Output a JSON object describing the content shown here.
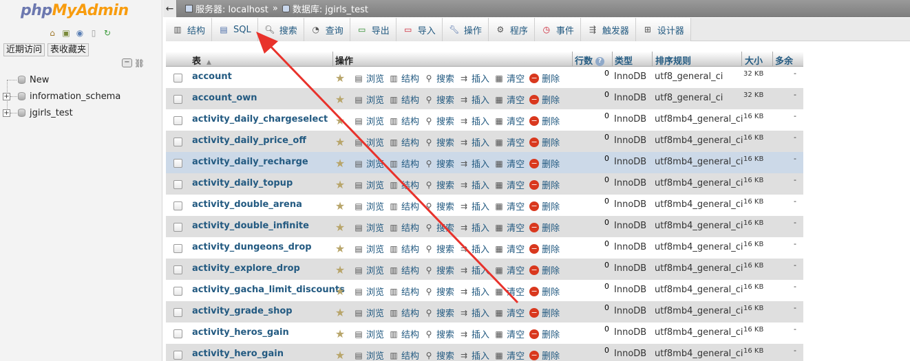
{
  "logo": {
    "part1": "php",
    "part2": "MyAdmin"
  },
  "left": {
    "icons": [
      "home-icon",
      "logout-icon",
      "help-icon",
      "docs-icon",
      "reload-icon"
    ],
    "nav_tabs": [
      "近期访问",
      "表收藏夹"
    ],
    "tree": [
      {
        "label": "New"
      },
      {
        "label": "information_schema"
      },
      {
        "label": "jgirls_test"
      }
    ]
  },
  "breadcrumb": {
    "server_label": "服务器: localhost",
    "separator": "»",
    "db_label": "数据库: jgirls_test"
  },
  "tabs": [
    {
      "label": "结构",
      "icon": "structure-icon"
    },
    {
      "label": "SQL",
      "icon": "sql-icon"
    },
    {
      "label": "搜索",
      "icon": "search-icon"
    },
    {
      "label": "查询",
      "icon": "query-icon"
    },
    {
      "label": "导出",
      "icon": "export-icon"
    },
    {
      "label": "导入",
      "icon": "import-icon"
    },
    {
      "label": "操作",
      "icon": "wrench-icon"
    },
    {
      "label": "程序",
      "icon": "routines-icon"
    },
    {
      "label": "事件",
      "icon": "events-icon"
    },
    {
      "label": "触发器",
      "icon": "triggers-icon"
    },
    {
      "label": "设计器",
      "icon": "designer-icon"
    }
  ],
  "table": {
    "headers": {
      "table": "表",
      "actions": "操作",
      "rows": "行数",
      "type": "类型",
      "collation": "排序规则",
      "size": "大小",
      "overhead": "多余"
    },
    "action_labels": [
      "浏览",
      "结构",
      "搜索",
      "插入",
      "清空",
      "删除"
    ],
    "rows": [
      {
        "name": "account",
        "rows": "0",
        "type": "InnoDB",
        "collation": "utf8_general_ci",
        "size": "32 KB",
        "overhead": "-"
      },
      {
        "name": "account_own",
        "rows": "0",
        "type": "InnoDB",
        "collation": "utf8_general_ci",
        "size": "32 KB",
        "overhead": "-"
      },
      {
        "name": "activity_daily_chargeselect",
        "rows": "0",
        "type": "InnoDB",
        "collation": "utf8mb4_general_ci",
        "size": "16 KB",
        "overhead": "-"
      },
      {
        "name": "activity_daily_price_off",
        "rows": "0",
        "type": "InnoDB",
        "collation": "utf8mb4_general_ci",
        "size": "16 KB",
        "overhead": "-"
      },
      {
        "name": "activity_daily_recharge",
        "rows": "0",
        "type": "InnoDB",
        "collation": "utf8mb4_general_ci",
        "size": "16 KB",
        "overhead": "-"
      },
      {
        "name": "activity_daily_topup",
        "rows": "0",
        "type": "InnoDB",
        "collation": "utf8mb4_general_ci",
        "size": "16 KB",
        "overhead": "-"
      },
      {
        "name": "activity_double_arena",
        "rows": "0",
        "type": "InnoDB",
        "collation": "utf8mb4_general_ci",
        "size": "16 KB",
        "overhead": "-"
      },
      {
        "name": "activity_double_infinite",
        "rows": "0",
        "type": "InnoDB",
        "collation": "utf8mb4_general_ci",
        "size": "16 KB",
        "overhead": "-"
      },
      {
        "name": "activity_dungeons_drop",
        "rows": "0",
        "type": "InnoDB",
        "collation": "utf8mb4_general_ci",
        "size": "16 KB",
        "overhead": "-"
      },
      {
        "name": "activity_explore_drop",
        "rows": "0",
        "type": "InnoDB",
        "collation": "utf8mb4_general_ci",
        "size": "16 KB",
        "overhead": "-"
      },
      {
        "name": "activity_gacha_limit_discounts",
        "rows": "0",
        "type": "InnoDB",
        "collation": "utf8mb4_general_ci",
        "size": "16 KB",
        "overhead": "-"
      },
      {
        "name": "activity_grade_shop",
        "rows": "0",
        "type": "InnoDB",
        "collation": "utf8mb4_general_ci",
        "size": "16 KB",
        "overhead": "-"
      },
      {
        "name": "activity_heros_gain",
        "rows": "0",
        "type": "InnoDB",
        "collation": "utf8mb4_general_ci",
        "size": "16 KB",
        "overhead": "-"
      },
      {
        "name": "activity_hero_gain",
        "rows": "0",
        "type": "InnoDB",
        "collation": "utf8mb4_general_ci",
        "size": "16 KB",
        "overhead": "-"
      }
    ]
  },
  "colors": {
    "link": "#235a81",
    "arrow": "#e8322b",
    "highlight_row": "#ccd9e8"
  }
}
